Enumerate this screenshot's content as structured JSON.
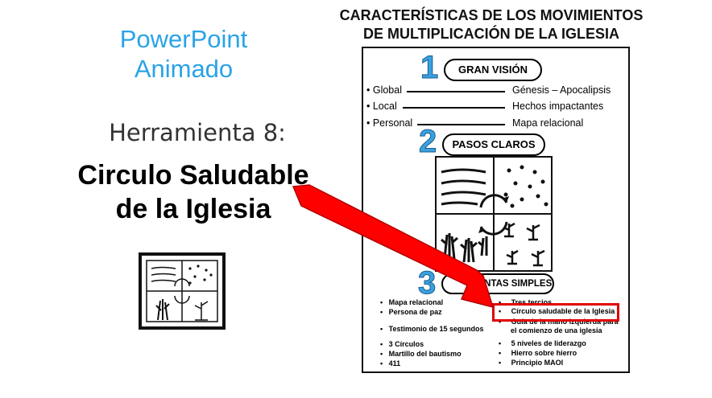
{
  "left": {
    "title_line1": "PowerPoint",
    "title_line2": "Animado",
    "tool_label": "Herramienta 8:",
    "tool_name_line1": "Circulo Saludable",
    "tool_name_line2": "de la Iglesia"
  },
  "doc": {
    "title_line1": "CARACTERÍSTICAS DE LOS MOVIMIENTOS",
    "title_line2": "DE MULTIPLICACIÓN DE LA IGLESIA",
    "sections": [
      {
        "number": "1",
        "label": "GRAN VISIÓN"
      },
      {
        "number": "2",
        "label": "PASOS CLAROS"
      },
      {
        "number": "3",
        "label": "HERRAMIENTAS SIMPLES",
        "visible_label": "MIENTAS SIMPLES"
      }
    ],
    "vision_rows": [
      {
        "left": "• Global",
        "right": "Génesis – Apocalipsis"
      },
      {
        "left": "• Local",
        "right": "Hechos impactantes"
      },
      {
        "left": "• Personal",
        "right": "Mapa relacional"
      }
    ],
    "tools_left": [
      "Mapa relacional",
      "Persona de paz",
      "Testimonio de 15 segundos",
      "3 Círculos",
      "Martillo del bautismo",
      "411"
    ],
    "tools_right": [
      "Tres tercios",
      "Círculo saludable de la Iglesia",
      "Guía de la mano izquierda para",
      "el comienzo de una iglesia",
      "5 niveles de liderazgo",
      "Hierro sobre hierro",
      "Principio MAOI"
    ],
    "highlight_color": "#e00000"
  },
  "arrow_color": "#ff0000"
}
